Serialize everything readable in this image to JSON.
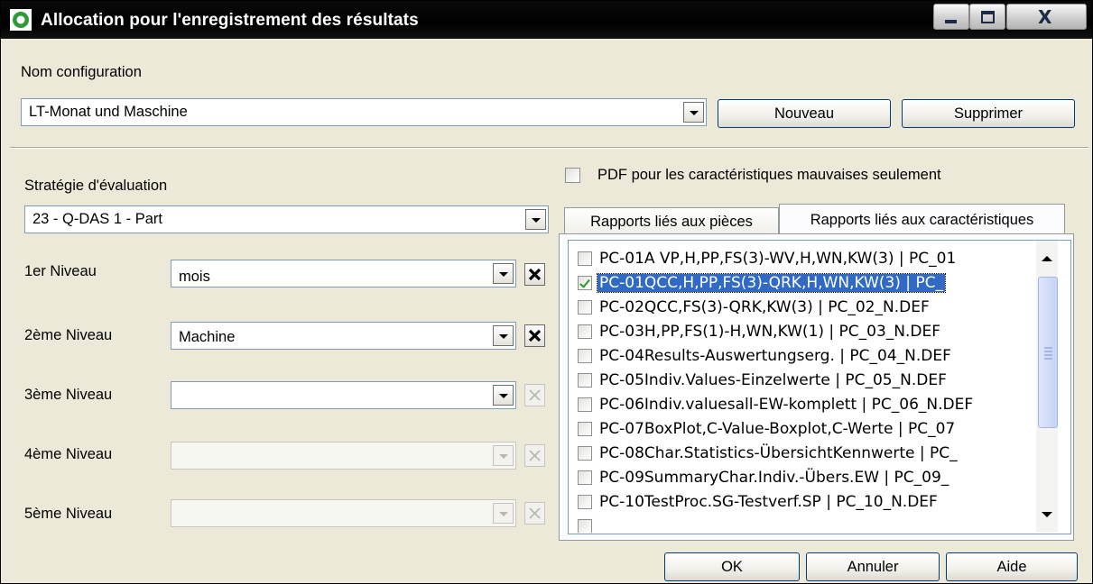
{
  "window": {
    "title": "Allocation pour l'enregistrement des résultats",
    "close_glyph": "X"
  },
  "config": {
    "label": "Nom configuration",
    "value": "LT-Monat und Maschine",
    "new_button": "Nouveau",
    "delete_button": "Supprimer"
  },
  "strategy": {
    "label": "Stratégie d'évaluation",
    "value": "23 - Q-DAS 1 - Part"
  },
  "levels": [
    {
      "label": "1er Niveau",
      "value": "mois",
      "enabled": true
    },
    {
      "label": "2ème Niveau",
      "value": "Machine",
      "enabled": true
    },
    {
      "label": "3ème Niveau",
      "value": "",
      "enabled": true
    },
    {
      "label": "4ème Niveau",
      "value": "",
      "enabled": false
    },
    {
      "label": "5ème Niveau",
      "value": "",
      "enabled": false
    }
  ],
  "pdf_option": {
    "label": "PDF pour les caractéristiques mauvaises seulement",
    "checked": false
  },
  "tabs": [
    {
      "label": "Rapports liés aux pièces",
      "active": false
    },
    {
      "label": "Rapports liés aux caractéristiques",
      "active": true
    }
  ],
  "reports": [
    {
      "text": "PC-01A VP,H,PP,FS(3)-WV,H,WN,KW(3) | PC_01",
      "checked": false,
      "selected": false
    },
    {
      "text": "PC-01QCC,H,PP,FS(3)-QRK,H,WN,KW(3) | PC_",
      "checked": true,
      "selected": true
    },
    {
      "text": "PC-02QCC,FS(3)-QRK,KW(3) | PC_02_N.DEF",
      "checked": false,
      "selected": false
    },
    {
      "text": "PC-03H,PP,FS(1)-H,WN,KW(1) | PC_03_N.DEF",
      "checked": false,
      "selected": false
    },
    {
      "text": "PC-04Results-Auswertungserg. | PC_04_N.DEF",
      "checked": false,
      "selected": false
    },
    {
      "text": "PC-05Indiv.Values-Einzelwerte | PC_05_N.DEF",
      "checked": false,
      "selected": false
    },
    {
      "text": "PC-06Indiv.valuesall-EW-komplett | PC_06_N.DEF",
      "checked": false,
      "selected": false
    },
    {
      "text": "PC-07BoxPlot,C-Value-Boxplot,C-Werte | PC_07",
      "checked": false,
      "selected": false
    },
    {
      "text": "PC-08Char.Statistics-ÜbersichtKennwerte | PC_",
      "checked": false,
      "selected": false
    },
    {
      "text": "PC-09SummaryChar.Indiv.-Übers.EW | PC_09_",
      "checked": false,
      "selected": false
    },
    {
      "text": "PC-10TestProc.SG-Testverf.SP | PC_10_N.DEF",
      "checked": false,
      "selected": false
    }
  ],
  "footer": {
    "ok": "OK",
    "cancel": "Annuler",
    "help": "Aide"
  }
}
